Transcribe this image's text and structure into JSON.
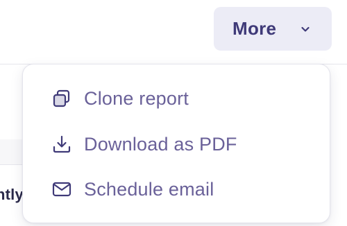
{
  "toolbar": {
    "more_label": "More"
  },
  "menu": {
    "items": [
      {
        "label": "Clone report",
        "icon": "clone-icon"
      },
      {
        "label": "Download as PDF",
        "icon": "download-icon"
      },
      {
        "label": "Schedule email",
        "icon": "mail-icon"
      }
    ]
  },
  "background": {
    "partial_text": "ntly"
  },
  "colors": {
    "accent": "#3f3a78",
    "menu_text": "#6a6199",
    "button_bg": "#ececf6"
  }
}
